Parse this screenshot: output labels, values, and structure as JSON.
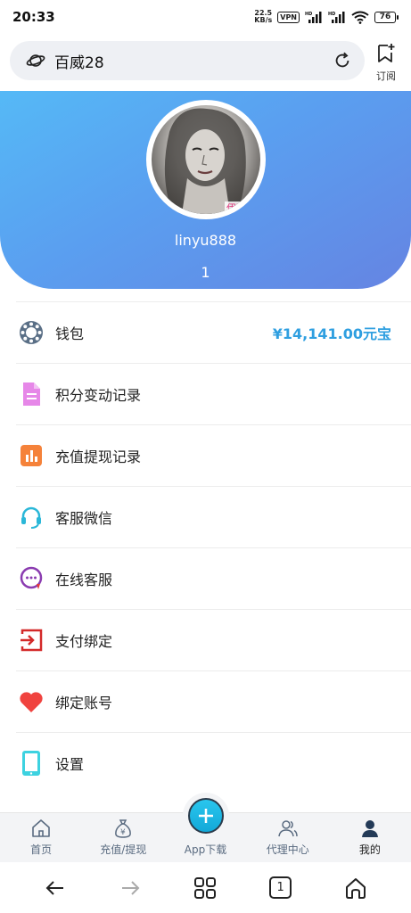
{
  "status_bar": {
    "time": "20:33",
    "speed_value": "22.5",
    "speed_unit": "KB/s",
    "vpn": "VPN",
    "battery": "76"
  },
  "browser": {
    "address_text": "百威28",
    "subscribe_label": "订阅"
  },
  "profile": {
    "username": "linyu888",
    "level": "1",
    "gradient_colors": [
      "#55b9f6",
      "#6584e2"
    ]
  },
  "menu": {
    "items": [
      {
        "label": "钱包",
        "value": "¥14,141.00元宝",
        "icon": "wallet-icon"
      },
      {
        "label": "积分变动记录",
        "icon": "document-icon"
      },
      {
        "label": "充值提现记录",
        "icon": "bar-chart-icon"
      },
      {
        "label": "客服微信",
        "icon": "headset-icon"
      },
      {
        "label": "在线客服",
        "icon": "chat-support-icon"
      },
      {
        "label": "支付绑定",
        "icon": "login-arrow-icon"
      },
      {
        "label": "绑定账号",
        "icon": "heart-icon"
      },
      {
        "label": "设置",
        "icon": "phone-icon"
      }
    ]
  },
  "tabbar": {
    "items": [
      {
        "label": "首页",
        "icon": "home-icon"
      },
      {
        "label": "充值/提现",
        "icon": "money-bag-icon"
      },
      {
        "label": "App下载",
        "icon": "plus-icon"
      },
      {
        "label": "代理中心",
        "icon": "users-icon"
      },
      {
        "label": "我的",
        "icon": "user-icon",
        "active": true
      }
    ]
  },
  "browser_nav": {
    "tab_count": "1"
  },
  "colors": {
    "accent_value": "#2f9fe0",
    "fab": "#13a8d8"
  }
}
